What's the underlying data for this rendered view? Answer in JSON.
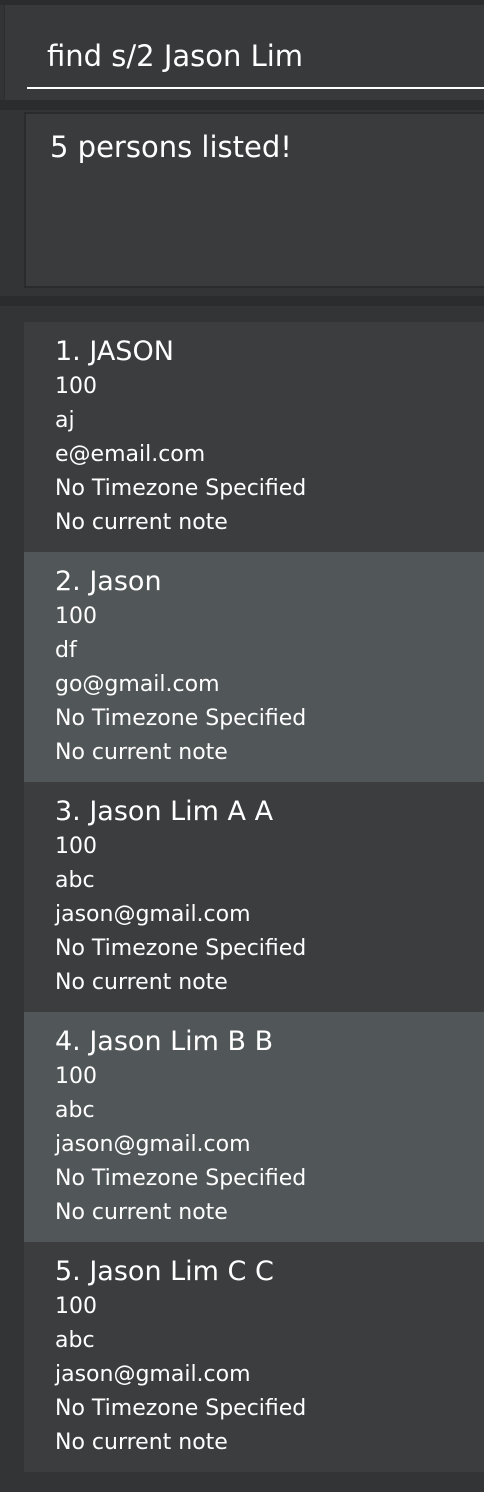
{
  "command": {
    "value": "find s/2 Jason Lim"
  },
  "result": {
    "message": "5 persons listed!"
  },
  "persons": [
    {
      "index_name": "1. JASON",
      "phone": "100",
      "address": "aj",
      "email": "e@email.com",
      "timezone": "No Timezone Specified",
      "note": "No current note"
    },
    {
      "index_name": "2. Jason",
      "phone": "100",
      "address": "df",
      "email": "go@gmail.com",
      "timezone": "No Timezone Specified",
      "note": "No current note"
    },
    {
      "index_name": "3. Jason Lim A A",
      "phone": "100",
      "address": "abc",
      "email": "jason@gmail.com",
      "timezone": "No Timezone Specified",
      "note": "No current note"
    },
    {
      "index_name": "4. Jason Lim B B",
      "phone": "100",
      "address": "abc",
      "email": "jason@gmail.com",
      "timezone": "No Timezone Specified",
      "note": "No current note"
    },
    {
      "index_name": "5. Jason Lim C C",
      "phone": "100",
      "address": "abc",
      "email": "jason@gmail.com",
      "timezone": "No Timezone Specified",
      "note": "No current note"
    }
  ],
  "colors": {
    "background": "#333436",
    "card_odd": "#3c3d3f",
    "card_even": "#515658",
    "text": "#ffffff"
  }
}
